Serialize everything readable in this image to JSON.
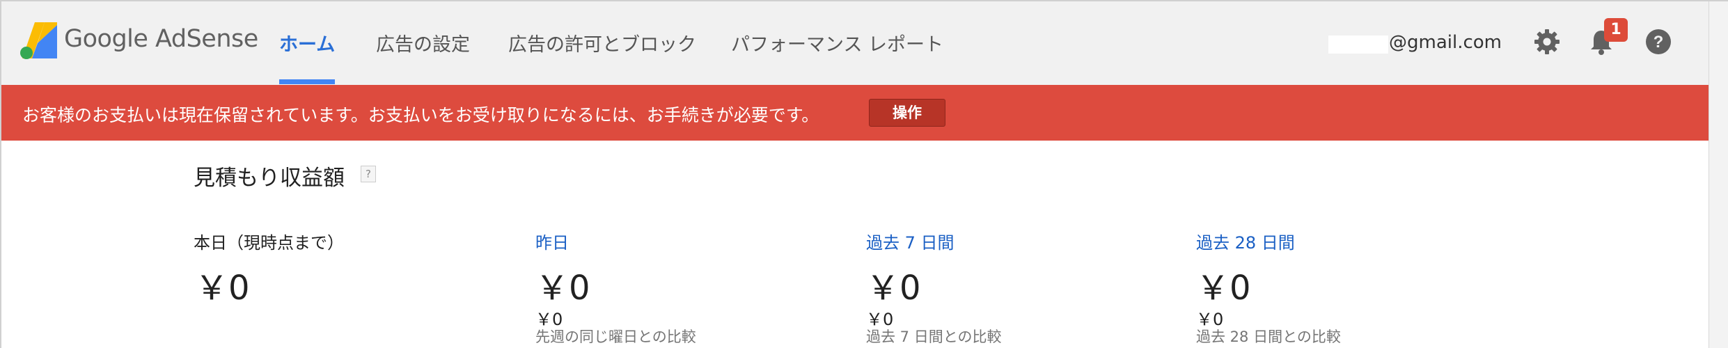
{
  "header": {
    "brand": "Google AdSense",
    "tabs": [
      {
        "label": "ホーム",
        "active": true
      },
      {
        "label": "広告の設定",
        "active": false
      },
      {
        "label": "広告の許可とブロック",
        "active": false
      },
      {
        "label": "パフォーマンス レポート",
        "active": false
      }
    ],
    "account_email": "@gmail.com",
    "notification_count": "1",
    "icons": {
      "settings": "gear-icon",
      "notifications": "bell-icon",
      "help": "help-icon"
    }
  },
  "alert": {
    "message": "お客様のお支払いは現在保留されています。お支払いをお受け取りになるには、お手続きが必要です。",
    "action_label": "操作",
    "color": "#dd4b3e"
  },
  "estimated_earnings": {
    "title": "見積もり収益額",
    "help": "?",
    "metrics": [
      {
        "label": "本日（現時点まで）",
        "value": "￥0"
      },
      {
        "label": "昨日",
        "value": "￥0",
        "compare_value": "￥0",
        "compare_note": "先週の同じ曜日との比較"
      },
      {
        "label": "過去 7 日間",
        "value": "￥0",
        "compare_value": "￥0",
        "compare_note": "過去 7 日間との比較"
      },
      {
        "label": "過去 28 日間",
        "value": "￥0",
        "compare_value": "￥0",
        "compare_note": "過去 28 日間との比較"
      }
    ]
  },
  "colors": {
    "accent": "#4285f4",
    "link": "#1a5fc4",
    "alert": "#dd4b3e"
  }
}
